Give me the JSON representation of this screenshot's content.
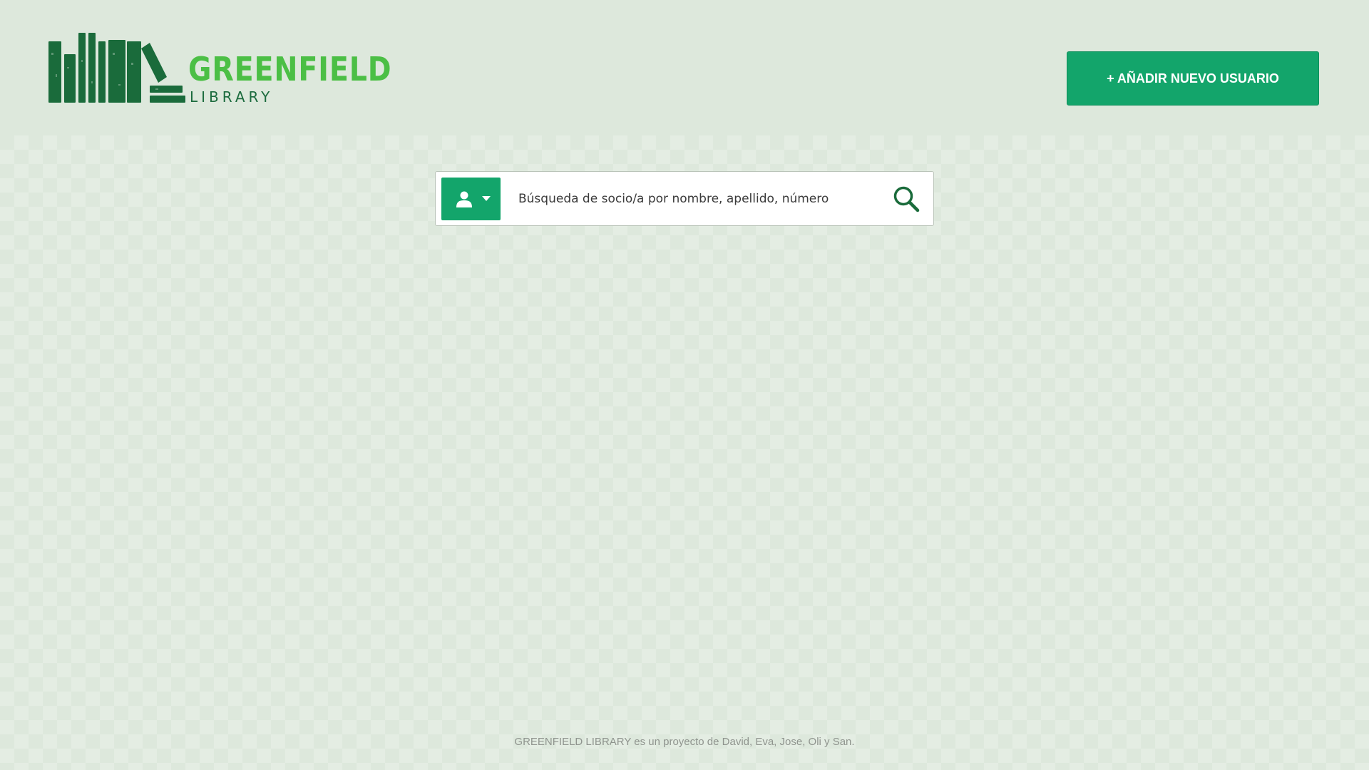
{
  "header": {
    "logo": {
      "title": "GREENFIELD",
      "subtitle": "LIBRARY",
      "title_color": "#4bbf45",
      "subtitle_color": "#1c6b3e",
      "books_color": "#1a6b3b"
    },
    "add_user_label": "+ AÑADIR NUEVO USUARIO"
  },
  "search": {
    "filter_icon": "user-icon",
    "filter_caret": "caret-down-icon",
    "placeholder": "Búsqueda de socio/a por nombre, apellido, número",
    "value": "",
    "submit_icon": "search-icon"
  },
  "footer": {
    "text": "GREENFIELD LIBRARY es un proyecto de David, Eva, Jose, Oli y San."
  },
  "colors": {
    "accent": "#13a56b",
    "background": "#dde8dc"
  }
}
